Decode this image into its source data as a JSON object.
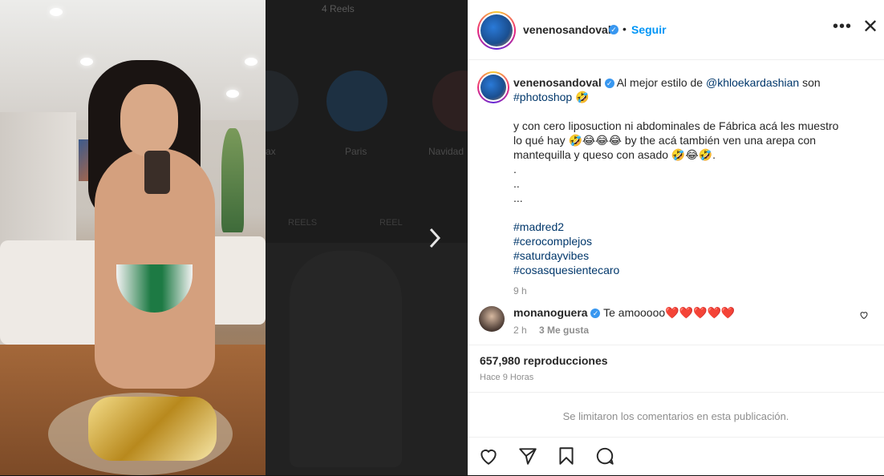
{
  "background_feed": {
    "top_label": "4 Reels",
    "highlights": [
      "ax",
      "Paris",
      "Navidad"
    ],
    "tabs": [
      "REELS",
      "REEL"
    ]
  },
  "post": {
    "username": "venenosandoval",
    "follow_label": "Seguir",
    "dot": "•",
    "more_label": "•••",
    "close_label": "✕",
    "caption": {
      "lead": "Al mejor estilo de",
      "mention": "@khloekardashian",
      "after_mention": "son",
      "tag_photoshop": "#photoshop",
      "emoji_1": "🤣",
      "para": "y con cero liposuction ni abdominales de Fábrica acá les muestro lo qué hay 🤣😂😂😂 by the acá también ven una arepa con mantequilla y queso con asado 🤣😂🤣.",
      "dots": [
        ".",
        "..",
        "..."
      ],
      "hashtags": [
        "#madred2",
        "#cerocomplejos",
        "#saturdayvibes",
        "#cosasquesientecaro"
      ],
      "time": "9 h"
    },
    "comment": {
      "username": "monanoguera",
      "text": "Te amooooo❤️❤️❤️❤️❤️",
      "time": "2 h",
      "likes": "3 Me gusta"
    },
    "views": "657,980 reproducciones",
    "ago": "Hace 9 Horas",
    "comments_limited": "Se limitaron los comentarios en esta publicación."
  },
  "icons": [
    "heart-icon",
    "send-icon",
    "bookmark-icon",
    "comment-icon",
    "verified-icon",
    "chevron-right-icon",
    "close-icon"
  ]
}
